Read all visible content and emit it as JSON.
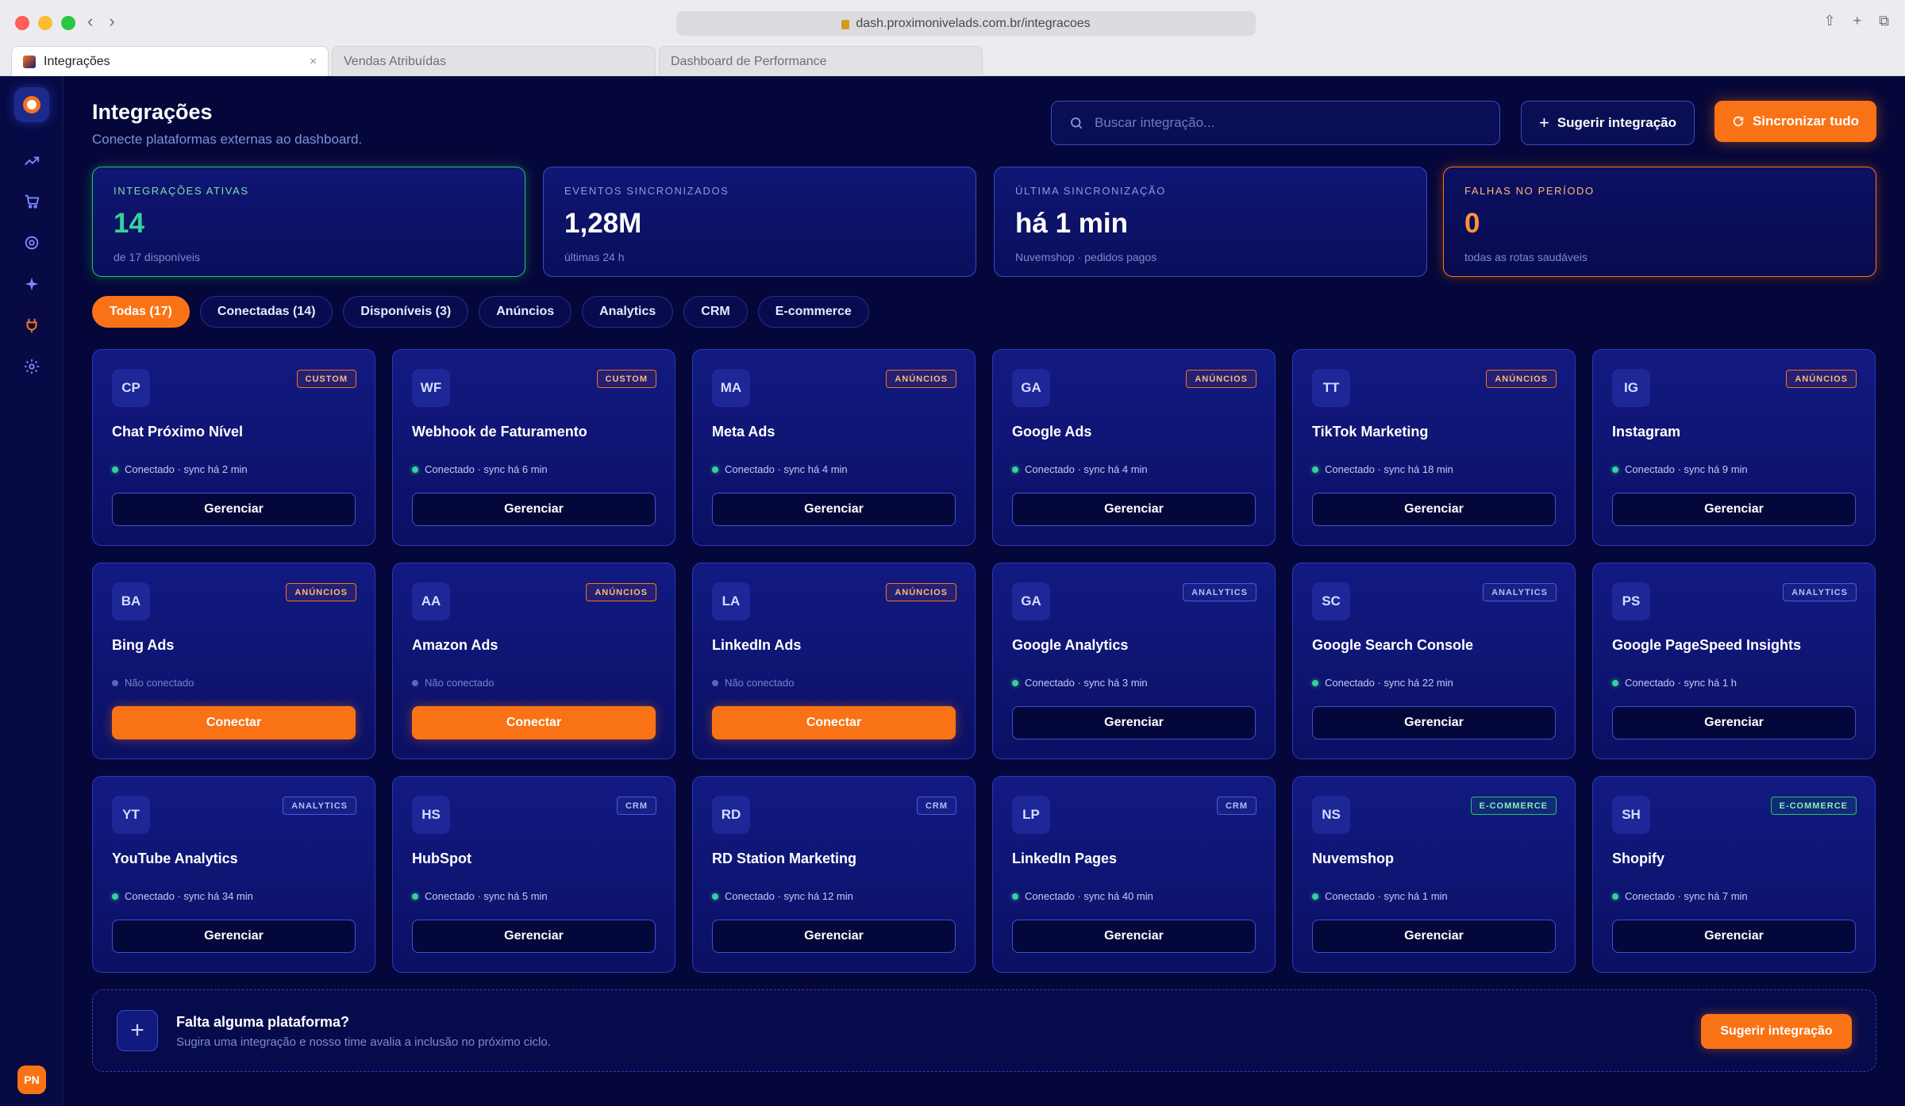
{
  "browser": {
    "url": "dash.proximonivelads.com.br/integracoes",
    "tabs": [
      {
        "label": "Integrações",
        "active": true
      },
      {
        "label": "Vendas Atribuídas",
        "active": false
      },
      {
        "label": "Dashboard de Performance",
        "active": false
      }
    ]
  },
  "sidebar": {
    "items": [
      {
        "icon": "trending-up-icon"
      },
      {
        "icon": "cart-icon"
      },
      {
        "icon": "target-icon"
      },
      {
        "icon": "sparkle-icon"
      },
      {
        "icon": "plug-icon",
        "active": true
      },
      {
        "icon": "gear-icon"
      }
    ],
    "avatar": "PN"
  },
  "header": {
    "title": "Integrações",
    "subtitle": "Conecte plataformas externas ao dashboard.",
    "search_placeholder": "Buscar integração...",
    "suggest_label": "Sugerir integração",
    "sync_label": "Sincronizar tudo"
  },
  "stats": [
    {
      "label": "INTEGRAÇÕES ATIVAS",
      "value": "14",
      "sub": "de 17 disponíveis",
      "accent": "#22c55e"
    },
    {
      "label": "EVENTOS SINCRONIZADOS",
      "value": "1,28M",
      "sub": "últimas 24 h"
    },
    {
      "label": "ÚLTIMA SINCRONIZAÇÃO",
      "value": "há 1 min",
      "sub": "Nuvemshop · pedidos pagos"
    },
    {
      "label": "FALHAS NO PERÍODO",
      "value": "0",
      "sub": "todas as rotas saudáveis",
      "accent": "#f97316"
    }
  ],
  "filters": [
    {
      "label": "Todas (17)",
      "active": true
    },
    {
      "label": "Conectadas (14)"
    },
    {
      "label": "Disponíveis (3)"
    },
    {
      "label": "Anúncios"
    },
    {
      "label": "Analytics"
    },
    {
      "label": "CRM"
    },
    {
      "label": "E-commerce"
    }
  ],
  "integrations": [
    {
      "initials": "CP",
      "badge": "CUSTOM",
      "kind": "custom",
      "name": "Chat Próximo Nível",
      "status": "Conectado · sync há 2 min",
      "connected": true,
      "action": "Gerenciar"
    },
    {
      "initials": "WF",
      "badge": "CUSTOM",
      "kind": "custom",
      "name": "Webhook de Faturamento",
      "status": "Conectado · sync há 6 min",
      "connected": true,
      "action": "Gerenciar"
    },
    {
      "initials": "MA",
      "badge": "ANÚNCIOS",
      "kind": "ads",
      "name": "Meta Ads",
      "status": "Conectado · sync há 4 min",
      "connected": true,
      "action": "Gerenciar"
    },
    {
      "initials": "GA",
      "badge": "ANÚNCIOS",
      "kind": "ads",
      "name": "Google Ads",
      "status": "Conectado · sync há 4 min",
      "connected": true,
      "action": "Gerenciar"
    },
    {
      "initials": "TT",
      "badge": "ANÚNCIOS",
      "kind": "ads",
      "name": "TikTok Marketing",
      "status": "Conectado · sync há 18 min",
      "connected": true,
      "action": "Gerenciar"
    },
    {
      "initials": "IG",
      "badge": "ANÚNCIOS",
      "kind": "ads",
      "name": "Instagram",
      "status": "Conectado · sync há 9 min",
      "connected": true,
      "action": "Gerenciar"
    },
    {
      "initials": "BA",
      "badge": "ANÚNCIOS",
      "kind": "ads",
      "name": "Bing Ads",
      "status": "Não conectado",
      "connected": false,
      "action": "Conectar"
    },
    {
      "initials": "AA",
      "badge": "ANÚNCIOS",
      "kind": "ads",
      "name": "Amazon Ads",
      "status": "Não conectado",
      "connected": false,
      "action": "Conectar"
    },
    {
      "initials": "LA",
      "badge": "ANÚNCIOS",
      "kind": "ads",
      "name": "LinkedIn Ads",
      "status": "Não conectado",
      "connected": false,
      "action": "Conectar"
    },
    {
      "initials": "GA",
      "badge": "ANALYTICS",
      "kind": "analytics",
      "name": "Google Analytics",
      "status": "Conectado · sync há 3 min",
      "connected": true,
      "action": "Gerenciar"
    },
    {
      "initials": "SC",
      "badge": "ANALYTICS",
      "kind": "analytics",
      "name": "Google Search Console",
      "status": "Conectado · sync há 22 min",
      "connected": true,
      "action": "Gerenciar"
    },
    {
      "initials": "PS",
      "badge": "ANALYTICS",
      "kind": "analytics",
      "name": "Google PageSpeed Insights",
      "status": "Conectado · sync há 1 h",
      "connected": true,
      "action": "Gerenciar"
    },
    {
      "initials": "YT",
      "badge": "ANALYTICS",
      "kind": "analytics",
      "name": "YouTube Analytics",
      "status": "Conectado · sync há 34 min",
      "connected": true,
      "action": "Gerenciar"
    },
    {
      "initials": "HS",
      "badge": "CRM",
      "kind": "crm",
      "name": "HubSpot",
      "status": "Conectado · sync há 5 min",
      "connected": true,
      "action": "Gerenciar"
    },
    {
      "initials": "RD",
      "badge": "CRM",
      "kind": "crm",
      "name": "RD Station Marketing",
      "status": "Conectado · sync há 12 min",
      "connected": true,
      "action": "Gerenciar"
    },
    {
      "initials": "LP",
      "badge": "CRM",
      "kind": "crm",
      "name": "LinkedIn Pages",
      "status": "Conectado · sync há 40 min",
      "connected": true,
      "action": "Gerenciar"
    },
    {
      "initials": "NS",
      "badge": "E-COMMERCE",
      "kind": "ecommerce",
      "name": "Nuvemshop",
      "status": "Conectado · sync há 1 min",
      "connected": true,
      "action": "Gerenciar"
    },
    {
      "initials": "SH",
      "badge": "E-COMMERCE",
      "kind": "ecommerce",
      "name": "Shopify",
      "status": "Conectado · sync há 7 min",
      "connected": true,
      "action": "Gerenciar"
    }
  ],
  "suggest_banner": {
    "title": "Falta alguma plataforma?",
    "text": "Sugira uma integração e nosso time avalia a inclusão no próximo ciclo.",
    "button": "Sugerir integração"
  },
  "colors": {
    "background": "#05073a",
    "accent": "#f97316",
    "success": "#22c55e",
    "card_border": "#2c38b8"
  }
}
